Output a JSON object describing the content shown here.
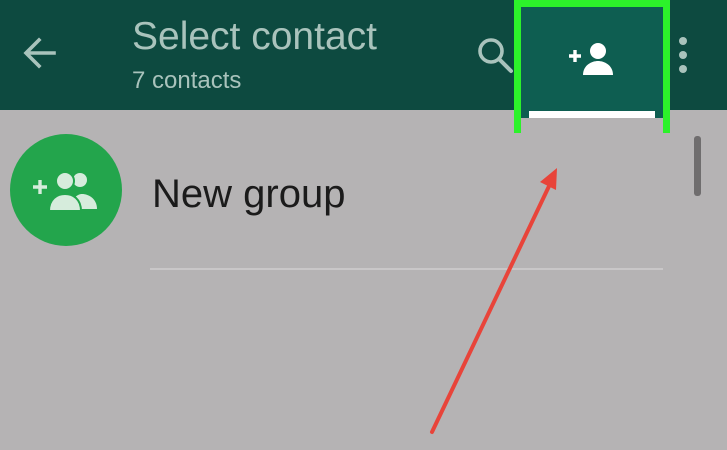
{
  "appbar": {
    "title": "Select contact",
    "subtitle": "7 contacts",
    "back_icon": "arrow-left-icon",
    "search_icon": "search-icon",
    "add_contact_icon": "person-add-icon",
    "overflow_icon": "more-vert-icon"
  },
  "list": {
    "items": [
      {
        "label": "New group",
        "icon": "group-add-icon"
      }
    ]
  },
  "colors": {
    "appbar": "#0d4a40",
    "highlight": "#2cf22a",
    "avatar": "#23a54c",
    "arrow": "#e8443a",
    "background": "#b5b3b4"
  }
}
